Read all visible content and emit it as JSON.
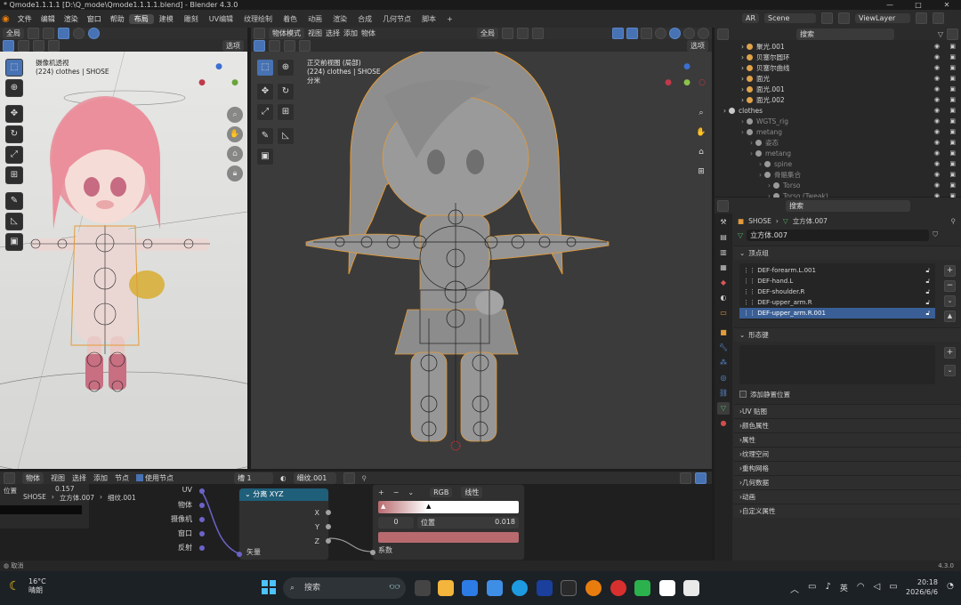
{
  "titlebar": {
    "title": "* Qmode1.1.1.1 [D:\\Q_mode\\Qmode1.1.1.1.blend] - Blender 4.3.0"
  },
  "menus": [
    "文件",
    "编辑",
    "渲染",
    "窗口",
    "帮助"
  ],
  "workspaces": [
    "布局",
    "建模",
    "雕刻",
    "UV编辑",
    "纹理绘制",
    "着色",
    "动画",
    "渲染",
    "合成",
    "几何节点",
    "脚本",
    "+"
  ],
  "active_workspace": "布局",
  "scene": {
    "engine": "AR",
    "name": "Scene",
    "view_layer": "ViewLayer"
  },
  "left_viewport": {
    "header_mode": "全局",
    "select_label": "选项",
    "title": "摄像机透视",
    "subtitle": "(224) clothes | SHOSE"
  },
  "right_viewport": {
    "header_mode": "物体模式",
    "menus": [
      "视图",
      "选择",
      "添加",
      "物体"
    ],
    "orientation": "全局",
    "select_label": "选项",
    "title": "正交前视图 (局部)",
    "subtitle": "(224) clothes | SHOSE",
    "units": "分米"
  },
  "outliner": {
    "search_placeholder": "搜索",
    "rows": [
      {
        "label": "聚光.001",
        "indent": 2,
        "color": "#e0a34a"
      },
      {
        "label": "贝塞尔圆环",
        "indent": 2,
        "color": "#e0a34a"
      },
      {
        "label": "贝塞尔曲线",
        "indent": 2,
        "color": "#e0a34a"
      },
      {
        "label": "面光",
        "indent": 2,
        "color": "#e0a34a"
      },
      {
        "label": "面光.001",
        "indent": 2,
        "color": "#e0a34a"
      },
      {
        "label": "面光.002",
        "indent": 2,
        "color": "#e0a34a"
      },
      {
        "label": "clothes",
        "indent": 0,
        "color": "#c9c9c9"
      },
      {
        "label": "WGTS_rig",
        "indent": 2,
        "color": "#9a9a9a",
        "dim": true
      },
      {
        "label": "metang",
        "indent": 2,
        "color": "#9a9a9a",
        "dim": true
      },
      {
        "label": "姿态",
        "indent": 3,
        "color": "#9a9a9a",
        "dim": true
      },
      {
        "label": "metang",
        "indent": 3,
        "color": "#9a9a9a",
        "dim": true
      },
      {
        "label": "spine",
        "indent": 4,
        "color": "#9a9a9a",
        "dim": true
      },
      {
        "label": "骨骼集合",
        "indent": 4,
        "color": "#9a9a9a",
        "dim": true
      },
      {
        "label": "Torso",
        "indent": 5,
        "color": "#9a9a9a",
        "dim": true
      },
      {
        "label": "Torso (Tweak)",
        "indent": 5,
        "color": "#9a9a9a",
        "dim": true
      }
    ]
  },
  "properties": {
    "search_placeholder": "搜索",
    "breadcrumb_object": "SHOSE",
    "breadcrumb_mesh": "立方体.007",
    "mesh_name": "立方体.007",
    "vertex_groups_title": "顶点组",
    "vertex_groups": [
      "DEF-forearm.L.001",
      "DEF-hand.L",
      "DEF-shoulder.R",
      "DEF-upper_arm.R",
      "DEF-upper_arm.R.001"
    ],
    "selected_vertex_group": "DEF-upper_arm.R.001",
    "shape_keys_title": "形态键",
    "add_rest_position": "添加静置位置",
    "sections": [
      "UV 贴图",
      "颜色属性",
      "属性",
      "纹理空间",
      "重构网格",
      "几何数据",
      "动画",
      "自定义属性"
    ]
  },
  "node_editor": {
    "header": [
      "物体",
      "视图",
      "选择",
      "添加",
      "节点"
    ],
    "use_nodes": "使用节点",
    "slot": "槽 1",
    "material": "细纹.001",
    "left_value_label": "位置",
    "left_value": "0.157",
    "breadcrumb": [
      "SHOSE",
      "立方体.007",
      "细纹.001"
    ],
    "texcoord_outputs": [
      "UV",
      "物体",
      "摄像机",
      "窗口",
      "反射"
    ],
    "separate_node": {
      "title": "分离 XYZ",
      "outputs": [
        "X",
        "Y",
        "Z"
      ],
      "input": "矢量"
    },
    "ramp": {
      "mode": "RGB",
      "interp": "线性",
      "index": "0",
      "pos_label": "位置",
      "pos_value": "0.018",
      "output": "系数"
    }
  },
  "status": {
    "left": "取消",
    "version": "4.3.0"
  },
  "taskbar": {
    "weather_temp": "16°C",
    "weather_desc": "晴朗",
    "search_placeholder": "搜索",
    "ime": "英",
    "time": "20:18",
    "date": "2026/6/6"
  },
  "colors": {
    "accent": "#4772b3",
    "selection": "#3a5f96",
    "outline": "#e39a36",
    "node_header": "#1f5f7a"
  }
}
